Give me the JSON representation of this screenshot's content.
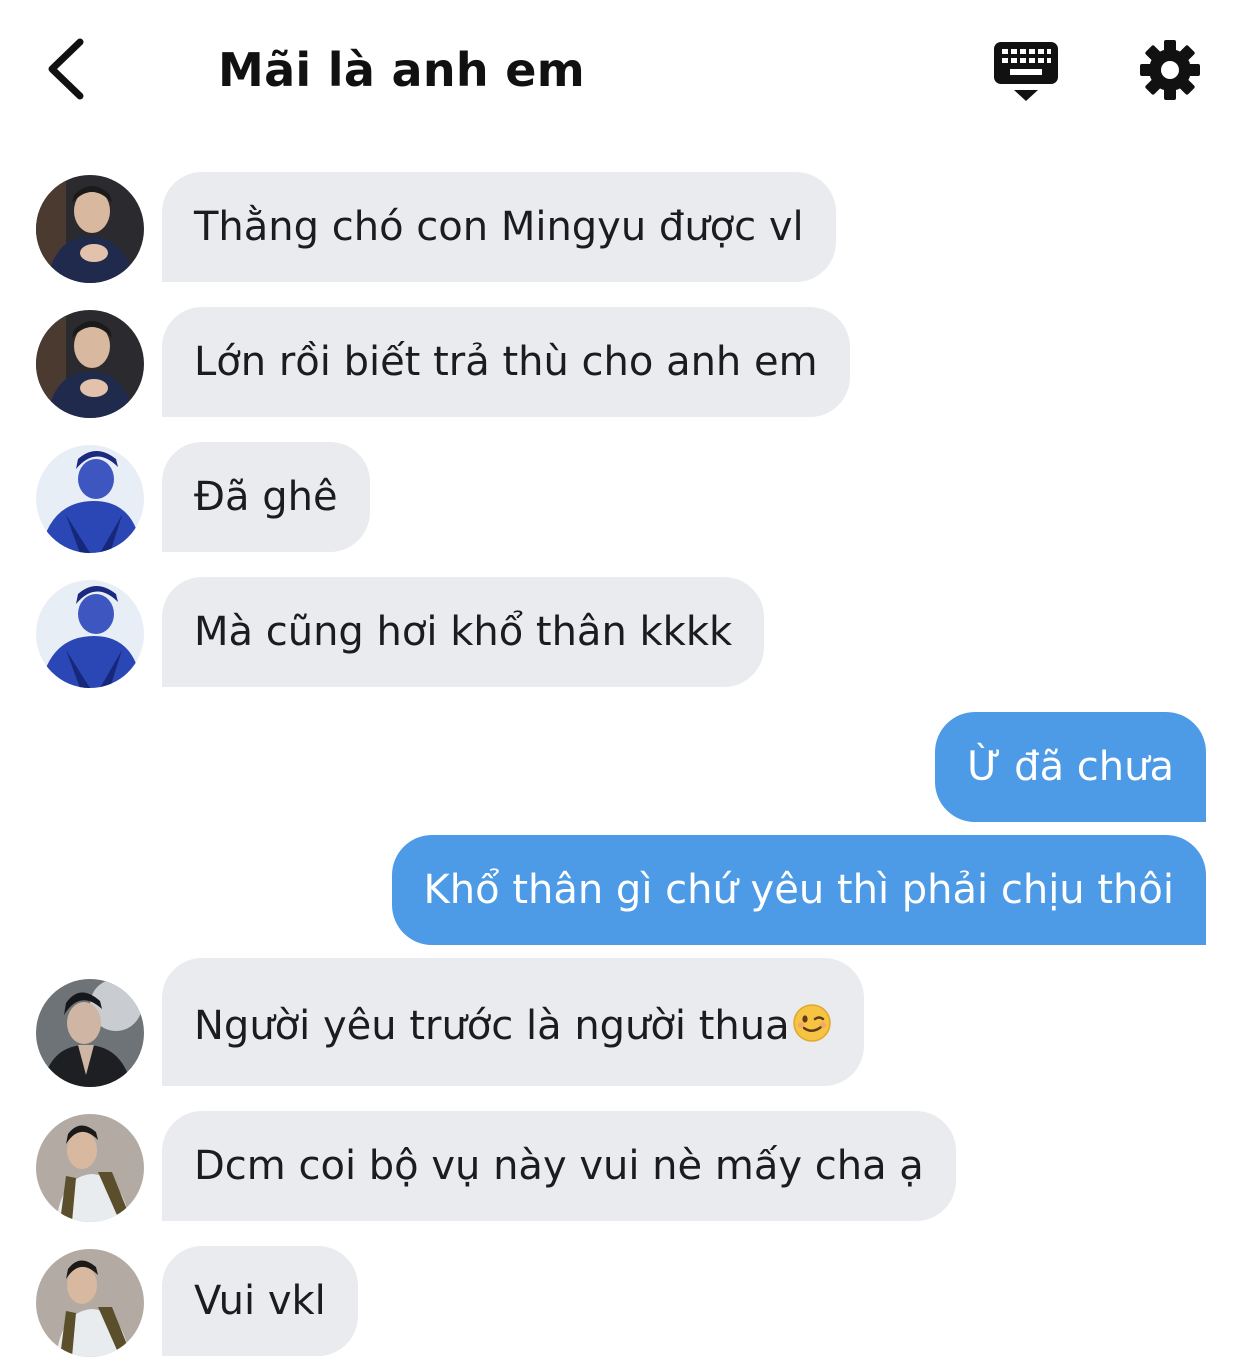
{
  "header": {
    "back_icon": "chevron-left-icon",
    "title": "Mãi là anh em",
    "keyboard_icon": "keyboard-icon",
    "settings_icon": "gear-icon"
  },
  "messages": [
    {
      "direction": "incoming",
      "avatar": "avatar-1",
      "text": "Thằng chó con Mingyu được vl"
    },
    {
      "direction": "incoming",
      "avatar": "avatar-1",
      "text": "Lớn rồi biết trả thù cho anh em"
    },
    {
      "direction": "incoming",
      "avatar": "avatar-2",
      "text": "Đã ghê"
    },
    {
      "direction": "incoming",
      "avatar": "avatar-2",
      "text": "Mà cũng hơi khổ thân kkkk"
    },
    {
      "direction": "outgoing",
      "text": "Ừ đã chưa"
    },
    {
      "direction": "outgoing",
      "text": "Khổ thân gì chứ yêu thì phải chịu thôi"
    },
    {
      "direction": "incoming",
      "avatar": "avatar-3",
      "text": "Người yêu trước là người thua",
      "emoji": "winking-face"
    },
    {
      "direction": "incoming",
      "avatar": "avatar-4",
      "text": "Dcm coi bộ vụ này vui nè mấy cha ạ"
    },
    {
      "direction": "incoming",
      "avatar": "avatar-4",
      "text": "Vui vkl"
    }
  ],
  "colors": {
    "incoming_bubble": "#e9ebef",
    "outgoing_bubble": "#4d9be6",
    "outgoing_text": "#ffffff"
  }
}
